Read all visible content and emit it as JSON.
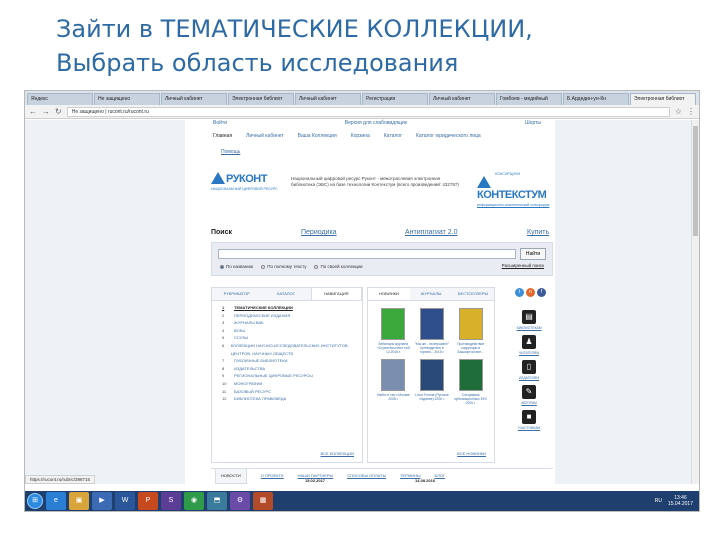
{
  "slide": {
    "title_line1": "Зайти в ТЕМАТИЧЕСКИЕ КОЛЛЕКЦИИ,",
    "title_line2": "Выбрать область исследования"
  },
  "browser": {
    "tabs": [
      {
        "label": "Яндекс"
      },
      {
        "label": "Не защищено"
      },
      {
        "label": "Личный кабинет"
      },
      {
        "label": "Электронная библиот"
      },
      {
        "label": "Личный кабинет"
      },
      {
        "label": "Регистрация"
      },
      {
        "label": "Личный кабинет"
      },
      {
        "label": "Гомбоев - медийный"
      },
      {
        "label": "Б.Ардедин-ун-Кн"
      },
      {
        "label": "Электронная библиот"
      }
    ],
    "active_tab": 9,
    "url": "Не защищено | rucont.ru/rucont.ru"
  },
  "site": {
    "toprow_left": "Войти",
    "toprow_center": "Версия для слабовидящих",
    "toprow_right": "Шорты",
    "menu": [
      "Главная",
      "Личный кабинет",
      "Ваша Коллекция",
      "Корзина",
      "Каталог",
      "Каталог юридического лица"
    ],
    "help": "Помощь",
    "logo1_text": "РУКОНТ",
    "logo1_sub": "НАЦИОНАЛЬНЫЙ ЦИФРОВОЙ РЕСУРС",
    "logo_desc": "Национальный цифровой ресурс Руконт - межотраслевая электронная библиотека (ЭБС) на базе технологии Контекстум (всего произведений: 432797)",
    "logo2_top": "КОНСОРЦИУМ",
    "logo2_text": "КОНТЕКСТУМ",
    "logo2_sub": "информационно-аналитический консорциум",
    "search": {
      "label": "Поиск",
      "periodika": "Периодика",
      "antiplagiat": "Антиплагиат 2.0",
      "buy": "Купить",
      "find_button": "Найти",
      "options": [
        "По названию",
        "По полному тексту",
        "По своей коллекции"
      ],
      "advanced": "Расширенный поиск"
    },
    "left_tabs": [
      "РУБРИКАТОР",
      "КАТАЛОГ",
      "НАВИГАЦИЯ"
    ],
    "left_active": 2,
    "collections": [
      {
        "n": "1",
        "label": "ТЕМАТИЧЕСКИЕ КОЛЛЕКЦИИ"
      },
      {
        "n": "2",
        "label": "ПЕРИОДИЧЕСКИЕ ИЗДАНИЯ"
      },
      {
        "n": "3",
        "label": "ЖУРНАЛЫ ВАК"
      },
      {
        "n": "4",
        "label": "ВУЗЫ"
      },
      {
        "n": "5",
        "label": "ССУЗЫ"
      },
      {
        "n": "6",
        "label": "КОЛЛЕКЦИИ НАУЧНО-ИССЛЕДОВАТЕЛЬСКИХ ИНСТИТУТОВ, ЦЕНТРОВ, НАУЧНЫХ ОБЩЕСТВ"
      },
      {
        "n": "7",
        "label": "ПУБЛИЧНЫЕ БИБЛИОТЕКИ"
      },
      {
        "n": "8",
        "label": "ИЗДАТЕЛЬСТВА"
      },
      {
        "n": "9",
        "label": "РЕГИОНАЛЬНЫЕ ЦИФРОВЫЕ РЕСУРСЫ"
      },
      {
        "n": "10",
        "label": "МОНОГРАФИИ"
      },
      {
        "n": "11",
        "label": "БАЗОВЫЙ РЕСУРС"
      },
      {
        "n": "12",
        "label": "БИБЛИОТЕКА ПРАВОВЕДА"
      }
    ],
    "all_collections": "ВСЕ КОЛЛЕКЦИИ",
    "mid_tabs": [
      "НОВИНКИ",
      "ЖУРНАЛЫ",
      "БЕСТСЕЛЛЕРЫ"
    ],
    "mid_active": 0,
    "books": [
      {
        "caption": "Вебинары журнала «Строительство» №5 12.2016 г.",
        "color": "#3aa83a"
      },
      {
        "caption": "\"Мы же - на вершине!\" путеводитель в горном... 2016 г.",
        "color": "#2f4e8c"
      },
      {
        "caption": "Противодействие коррупции в Башкортостане...",
        "color": "#d9b02a"
      },
      {
        "caption": "Найти и так о Москве 2006 г.",
        "color": "#7a8fb0"
      },
      {
        "caption": "Linux Format (Русское Издание) 2006 г.",
        "color": "#2a4b7a"
      },
      {
        "caption": "Специфика публикационных 3ФС 2005 г.",
        "color": "#1f6e3a"
      }
    ],
    "all_new": "ВСЕ НОВИНКИ",
    "right_icons": [
      {
        "icon": "book-icon",
        "glyph": "▤",
        "label": "БИБЛИОТЕКАМ"
      },
      {
        "icon": "reader-icon",
        "glyph": "♟",
        "label": "ЧИТАТЕЛЯМ"
      },
      {
        "icon": "document-icon",
        "glyph": "▯",
        "label": "ИЗДАТЕЛЯМ"
      },
      {
        "icon": "pen-icon",
        "glyph": "✎",
        "label": "АВТОРАМ"
      },
      {
        "icon": "briefcase-icon",
        "glyph": "■",
        "label": "УЧАСТНИКАМ"
      }
    ],
    "bottom_tabs": [
      "НОВОСТИ",
      "О ПРОЕКТЕ",
      "НАШИ ПАРТНЕРЫ",
      "СПОСОБЫ ОПЛАТЫ",
      "ТЕРМИНЫ",
      "БЛОГ"
    ],
    "bottom_active": 0,
    "date1": "15.02.2017",
    "date2": "14.08.2016",
    "status_url": "https://rucont.ru/rubric/398715"
  },
  "taskbar": {
    "apps": [
      {
        "glyph": "e",
        "color": "#2a7fd4"
      },
      {
        "glyph": "▣",
        "color": "#d9a53a"
      },
      {
        "glyph": "▶",
        "color": "#3c6bb5"
      },
      {
        "glyph": "W",
        "color": "#2b579a"
      },
      {
        "glyph": "P",
        "color": "#c64a1d"
      },
      {
        "glyph": "S",
        "color": "#5b3d96"
      },
      {
        "glyph": "◉",
        "color": "#2f9a4a"
      },
      {
        "glyph": "⬒",
        "color": "#3a7a9a"
      },
      {
        "glyph": "⚙",
        "color": "#6a4ca8"
      },
      {
        "glyph": "▦",
        "color": "#b34a2a"
      }
    ],
    "lang": "RU",
    "time": "13:46",
    "date": "15.04.2017"
  }
}
